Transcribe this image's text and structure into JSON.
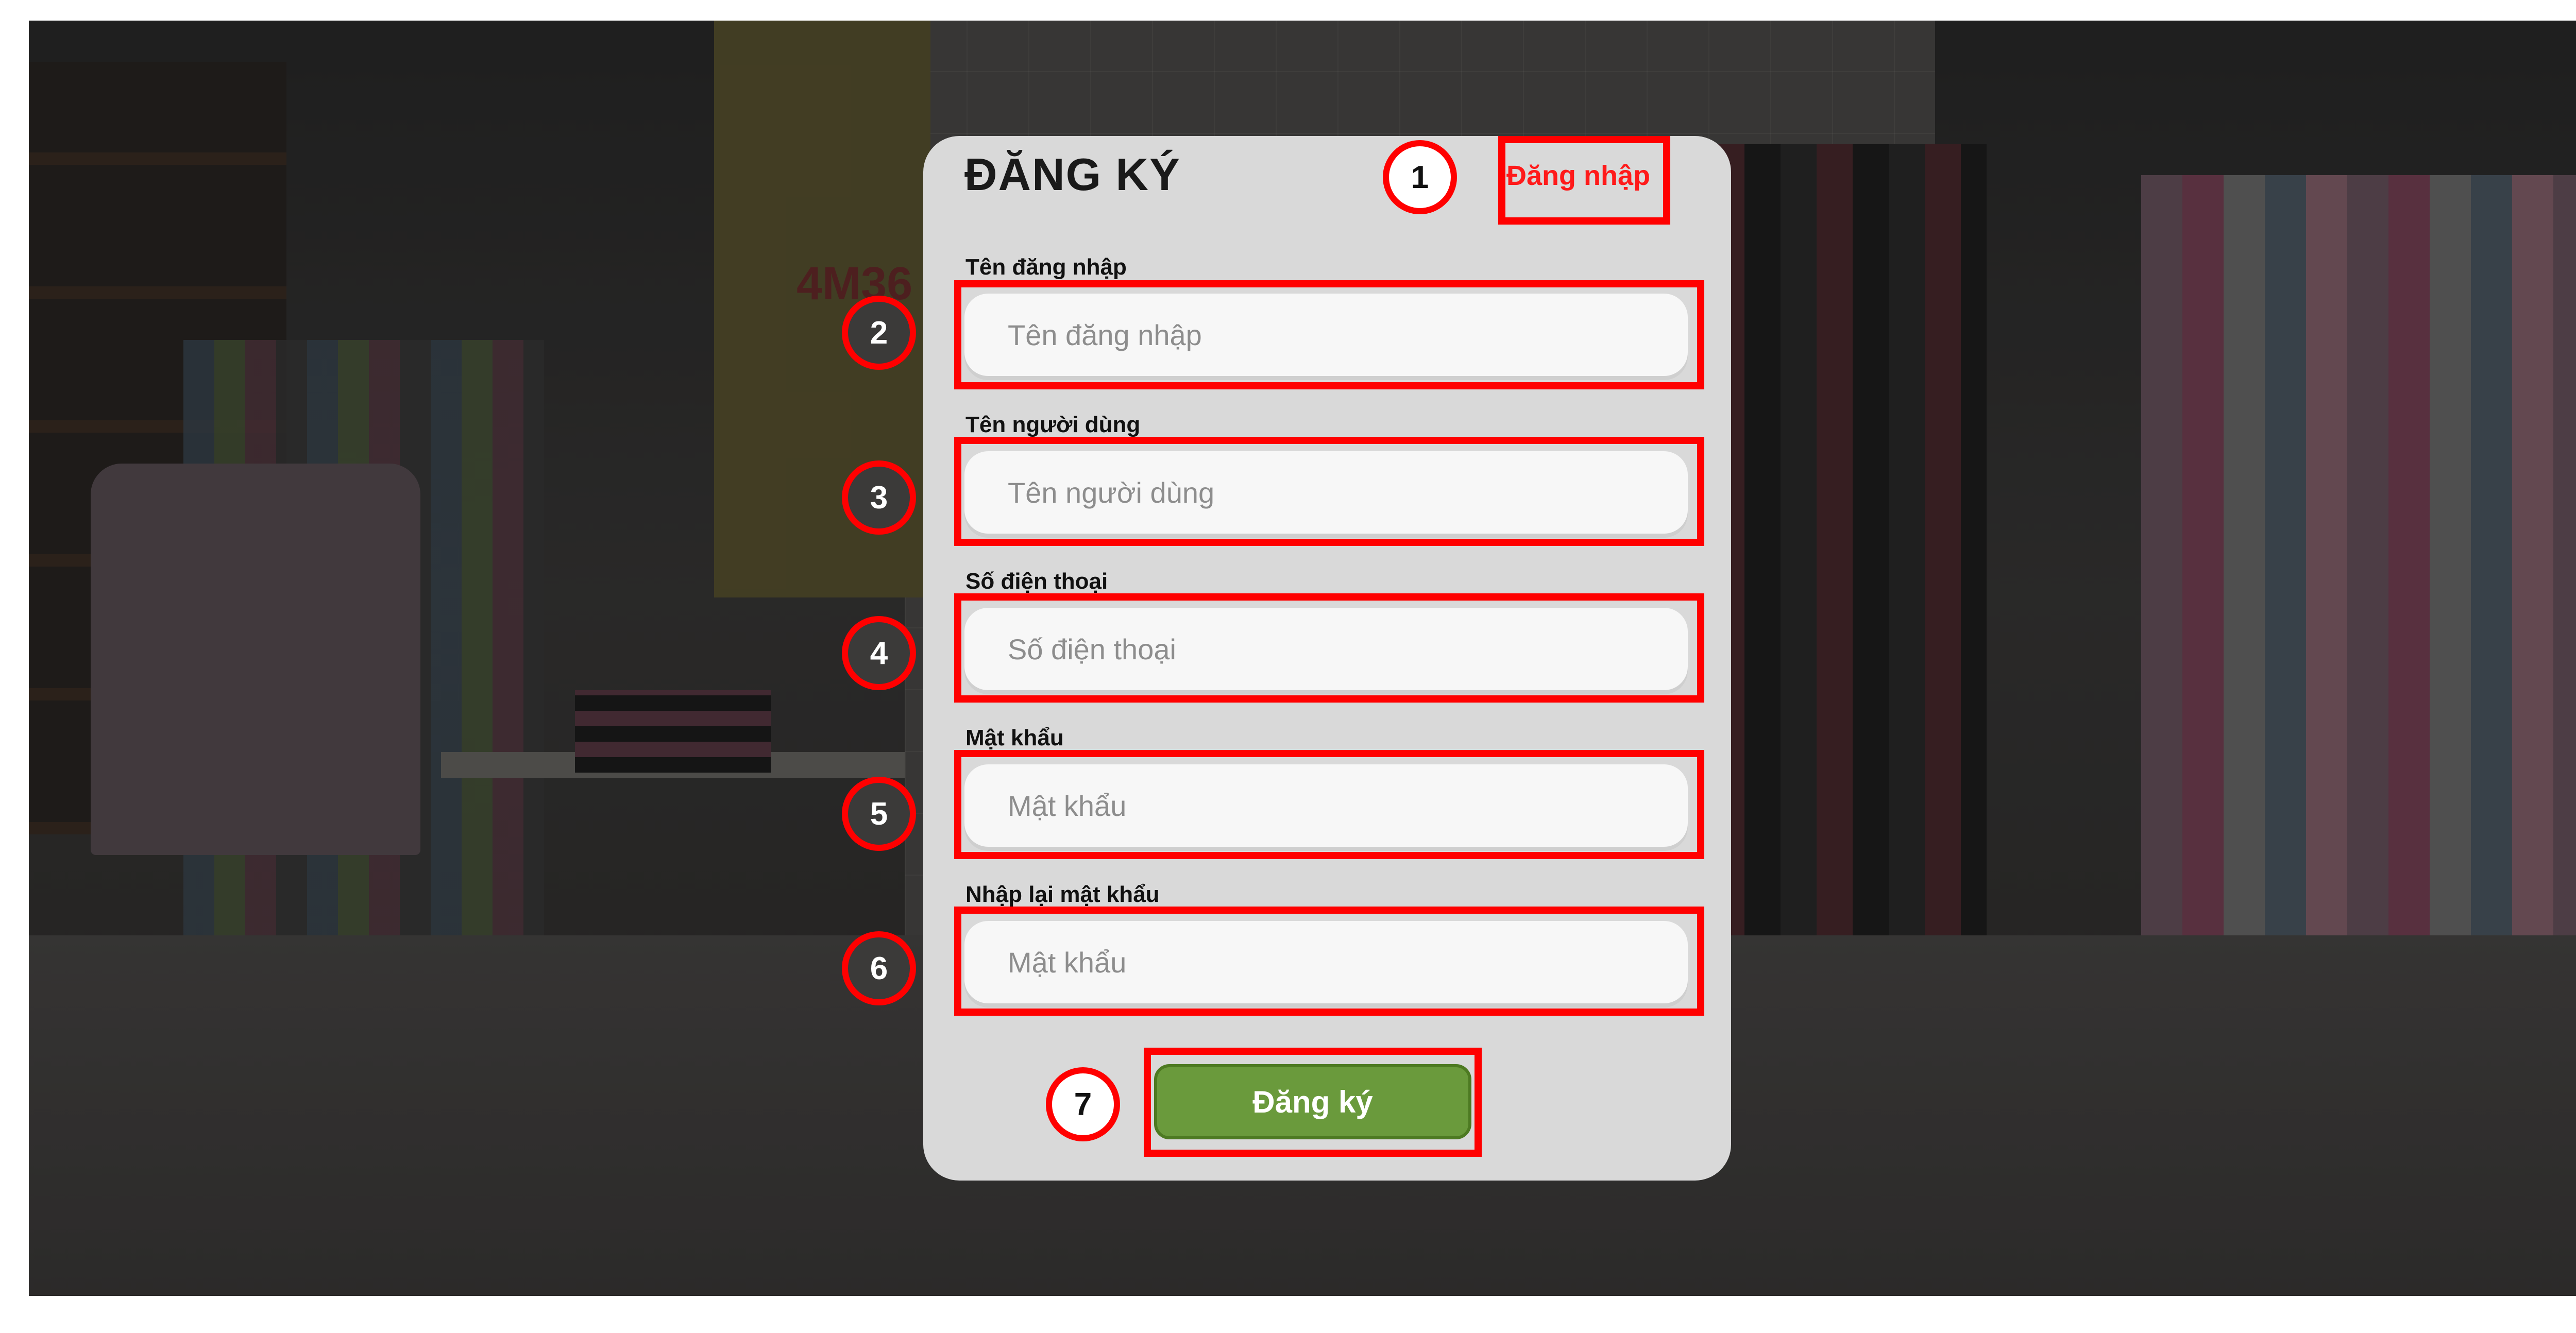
{
  "form": {
    "title": "ĐĂNG KÝ",
    "login_link": "Đăng nhập",
    "fields": [
      {
        "label": "Tên đăng nhập",
        "placeholder": "Tên đăng nhập"
      },
      {
        "label": "Tên người dùng",
        "placeholder": "Tên người dùng"
      },
      {
        "label": "Số điện thoại",
        "placeholder": "Số điện thoại"
      },
      {
        "label": "Mật khẩu",
        "placeholder": "Mật khẩu"
      },
      {
        "label": "Nhập lại mật khẩu",
        "placeholder": "Mật khẩu"
      }
    ],
    "submit_label": "Đăng ký"
  },
  "background": {
    "poster_text": "4M36"
  },
  "annotations": [
    "1",
    "2",
    "3",
    "4",
    "5",
    "6",
    "7"
  ],
  "colors": {
    "highlight": "#ff0000",
    "card": "#d9d9d9",
    "submit": "#6a9a3c",
    "link": "#ff1a1a"
  }
}
